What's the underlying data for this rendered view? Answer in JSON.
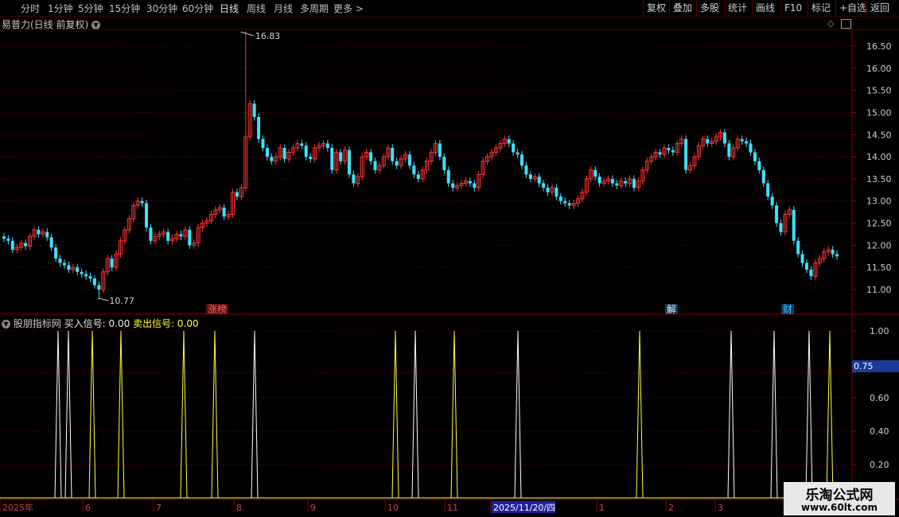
{
  "toolbar": {
    "periods": [
      "分时",
      "1分钟",
      "5分钟",
      "15分钟",
      "30分钟",
      "60分钟",
      "日线",
      "周线",
      "月线",
      "多周期",
      "更多 >"
    ],
    "active_period": "日线",
    "right_buttons": [
      "复权",
      "叠加",
      "多股",
      "统计",
      "画线",
      "F10",
      "标记",
      "+自选",
      "返回"
    ]
  },
  "main_panel": {
    "title": "易普力(日线 前复权)",
    "high_marker": "16.83",
    "low_marker": "10.77",
    "y_ticks": [
      "16.50",
      "16.00",
      "15.50",
      "15.00",
      "14.50",
      "14.00",
      "13.50",
      "13.00",
      "12.50",
      "12.00",
      "11.50",
      "11.00"
    ],
    "events": [
      {
        "label": "涨榜",
        "color": "#ff6060"
      },
      {
        "label": "解",
        "color": "#e8e8e8"
      },
      {
        "label": "财",
        "color": "#40c8ff"
      }
    ]
  },
  "indicator_panel": {
    "name": "股朋指标网",
    "buy_label": "买入信号: 0.00",
    "sell_label": "卖出信号: 0.00",
    "y_ticks": [
      "1.00",
      "0.75",
      "0.60",
      "0.40",
      "0.20"
    ],
    "current_value_box": "0.75"
  },
  "x_axis": {
    "labels": [
      "2025年",
      "6",
      "7",
      "8",
      "9",
      "10",
      "11",
      "2025/11/20/四",
      "1",
      "2",
      "3"
    ]
  },
  "watermark": {
    "line1": "乐淘公式网",
    "line2": "www.60lt.com"
  },
  "colors": {
    "up": "#ff3333",
    "down": "#40e0ff",
    "grid": "#5a0000",
    "buy_signal": "#ffff40",
    "sell_signal": "#ffffff"
  },
  "chart_data": {
    "type": "candlestick",
    "price_range": [
      10.77,
      16.83
    ],
    "closes": [
      12.15,
      12.1,
      11.9,
      11.95,
      12.05,
      11.98,
      12.2,
      12.35,
      12.25,
      12.3,
      12.18,
      11.95,
      11.7,
      11.6,
      11.55,
      11.45,
      11.5,
      11.4,
      11.35,
      11.3,
      11.25,
      11.1,
      11.0,
      11.4,
      11.7,
      11.5,
      11.8,
      12.1,
      12.35,
      12.6,
      12.9,
      13.0,
      12.95,
      12.4,
      12.1,
      12.2,
      12.25,
      12.3,
      12.1,
      12.15,
      12.25,
      12.2,
      12.35,
      12.0,
      12.05,
      12.4,
      12.5,
      12.55,
      12.7,
      12.8,
      12.85,
      12.65,
      12.7,
      13.2,
      13.1,
      13.3,
      14.45,
      15.2,
      14.9,
      14.4,
      14.2,
      14.0,
      13.9,
      14.0,
      14.2,
      13.95,
      14.1,
      14.2,
      14.3,
      14.25,
      14.0,
      13.95,
      14.2,
      14.25,
      14.3,
      14.2,
      13.7,
      14.1,
      13.9,
      14.15,
      13.6,
      13.4,
      13.55,
      14.0,
      14.1,
      13.9,
      13.7,
      13.8,
      14.0,
      14.2,
      13.9,
      13.8,
      13.95,
      14.05,
      13.8,
      13.6,
      13.5,
      13.7,
      13.9,
      14.1,
      14.3,
      14.0,
      13.7,
      13.4,
      13.3,
      13.35,
      13.4,
      13.45,
      13.4,
      13.3,
      13.6,
      13.9,
      14.0,
      14.1,
      14.2,
      14.3,
      14.4,
      14.3,
      14.1,
      14.05,
      13.8,
      13.6,
      13.5,
      13.55,
      13.4,
      13.3,
      13.2,
      13.3,
      13.1,
      13.0,
      12.95,
      12.9,
      12.95,
      13.05,
      13.2,
      13.5,
      13.7,
      13.55,
      13.4,
      13.45,
      13.5,
      13.4,
      13.35,
      13.45,
      13.4,
      13.5,
      13.3,
      13.45,
      13.7,
      13.9,
      14.0,
      14.1,
      14.05,
      14.2,
      14.15,
      14.1,
      14.3,
      14.4,
      13.7,
      13.8,
      14.0,
      14.25,
      14.4,
      14.3,
      14.35,
      14.45,
      14.55,
      14.3,
      14.0,
      14.2,
      14.4,
      14.35,
      14.3,
      14.1,
      13.9,
      13.7,
      13.4,
      13.1,
      12.9,
      12.5,
      12.3,
      12.7,
      12.8,
      12.1,
      11.8,
      11.6,
      11.45,
      11.3,
      11.6,
      11.7,
      11.85,
      11.9,
      11.8,
      11.75
    ]
  }
}
